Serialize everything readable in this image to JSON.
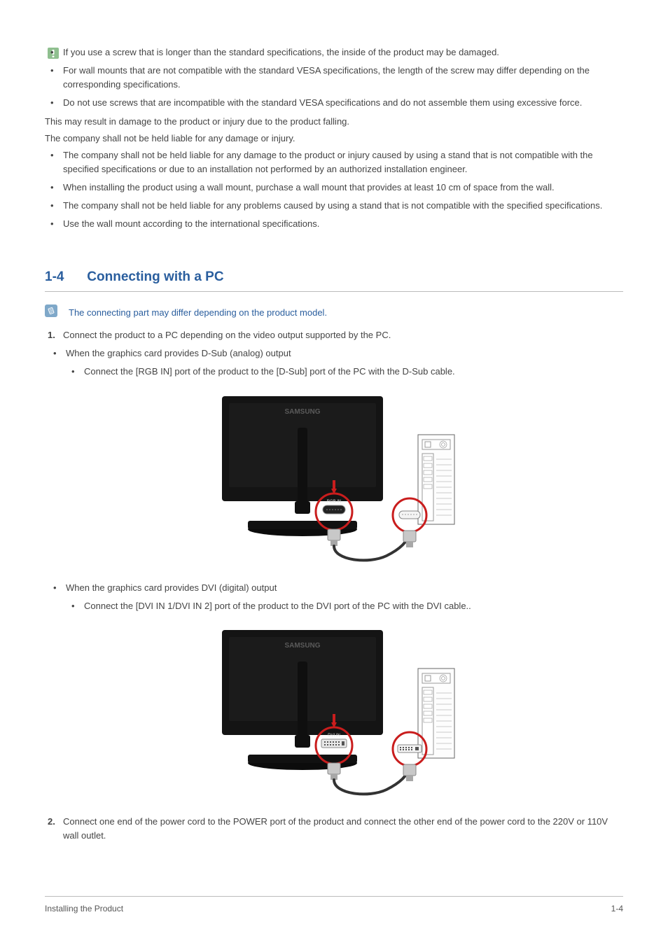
{
  "top": {
    "bullets1": [
      "If you use a screw that is longer than the standard specifications, the inside of the product may be damaged.",
      "For wall mounts that are not compatible with the standard VESA specifications, the length of the screw may differ depending on the corresponding specifications.",
      "Do not use screws that are incompatible with the standard VESA specifications and do not assemble them using excessive force."
    ],
    "para1": "This may result in damage to the product or injury due to the product falling.",
    "para2": "The company shall not be held liable for any damage or injury.",
    "bullets2": [
      "The company shall not be held liable for any damage to the product or injury caused by using a stand that is not compatible with the specified specifications or due to an installation not performed by an authorized installation engineer.",
      "When installing the product using a wall mount, purchase a wall mount that provides at least 10 cm of space from the wall.",
      "The company shall not be held liable for any problems caused by using a stand that is not compatible with the specified specifications.",
      "Use the wall mount according to the international specifications."
    ]
  },
  "section": {
    "number": "1-4",
    "title": "Connecting with a PC",
    "note": "The connecting part may differ depending on the product model.",
    "step1": "Connect the product to a PC depending on the video output supported by the PC.",
    "dsub_head": "When the graphics card provides D-Sub (analog) output",
    "dsub_item": "Connect the [RGB IN] port of the product to the [D-Sub] port of the PC with the D-Sub cable.",
    "dvi_head": "When the graphics card provides DVI (digital) output",
    "dvi_item": "Connect the [DVI IN 1/DVI IN 2] port of the product to the DVI port of the PC with the DVI cable..",
    "step2": "Connect one end of the power cord to the POWER port of the product and connect the other end of the power cord to the 220V or 110V wall outlet."
  },
  "figure1": {
    "brand": "SAMSUNG",
    "port_label": "RGB IN"
  },
  "figure2": {
    "brand": "SAMSUNG",
    "port_label": "DVI IN"
  },
  "footer": {
    "left": "Installing the Product",
    "right": "1-4"
  }
}
